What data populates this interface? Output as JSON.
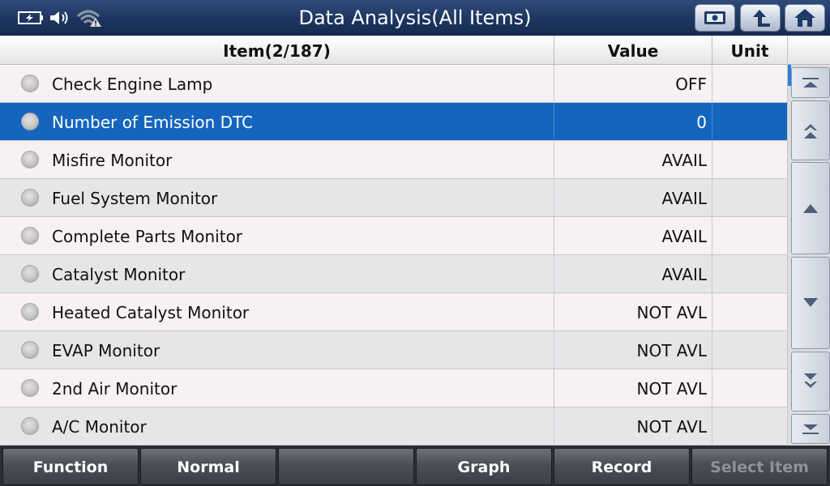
{
  "title": "Data Analysis(All Items)",
  "status_icons": [
    "battery-icon",
    "speaker-icon",
    "wifi-warning-icon"
  ],
  "toolbar_icons": [
    "screenshot-icon",
    "back-arrow-icon",
    "home-icon"
  ],
  "table": {
    "headers": {
      "item": "Item(2/187)",
      "value": "Value",
      "unit": "Unit"
    },
    "rows": [
      {
        "name": "Check Engine Lamp",
        "value": "OFF",
        "unit": ""
      },
      {
        "name": "Number of Emission DTC",
        "value": "0",
        "unit": ""
      },
      {
        "name": "Misfire Monitor",
        "value": "AVAIL",
        "unit": ""
      },
      {
        "name": "Fuel System Monitor",
        "value": "AVAIL",
        "unit": ""
      },
      {
        "name": "Complete Parts Monitor",
        "value": "AVAIL",
        "unit": ""
      },
      {
        "name": "Catalyst Monitor",
        "value": "AVAIL",
        "unit": ""
      },
      {
        "name": "Heated Catalyst Monitor",
        "value": "NOT AVL",
        "unit": ""
      },
      {
        "name": "EVAP Monitor",
        "value": "NOT AVL",
        "unit": ""
      },
      {
        "name": "2nd Air Monitor",
        "value": "NOT AVL",
        "unit": ""
      },
      {
        "name": "A/C Monitor",
        "value": "NOT AVL",
        "unit": ""
      }
    ],
    "selected_index": 1
  },
  "scrollbar_icons": [
    "scroll-top-icon",
    "page-up-icon",
    "line-up-icon",
    "line-down-icon",
    "page-down-icon",
    "scroll-bottom-icon"
  ],
  "bottom_buttons": {
    "function": "Function",
    "normal": "Normal",
    "empty": "",
    "graph": "Graph",
    "record": "Record",
    "select_item": "Select Item"
  },
  "colors": {
    "title_bar": "#1d3560",
    "selected_row": "#1565bf",
    "row_odd": "#f7f1f1",
    "row_even": "#e6e5e8"
  }
}
